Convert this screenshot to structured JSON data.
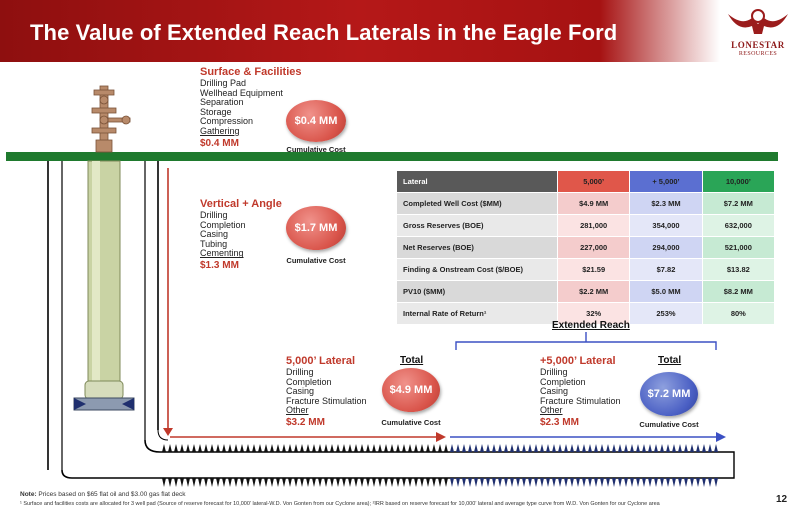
{
  "header": {
    "title": "The Value of Extended Reach Laterals in the Eagle Ford"
  },
  "logo": {
    "name": "LONESTAR",
    "sub": "RESOURCES"
  },
  "surface": {
    "title": "Surface & Facilities",
    "items": [
      "Drilling Pad",
      "Wellhead Equipment",
      "Separation",
      "Storage",
      "Compression",
      "Gathering"
    ],
    "amount": "$0.4 MM",
    "bubble": "$0.4 MM",
    "caption": "Cumulative Cost"
  },
  "vertical": {
    "title": "Vertical + Angle",
    "items": [
      "Drilling",
      "Completion",
      "Casing",
      "Tubing",
      "Cementing"
    ],
    "amount": "$1.3 MM",
    "bubble": "$1.7 MM",
    "caption": "Cumulative Cost"
  },
  "lateral5k": {
    "title": "5,000’ Lateral",
    "items": [
      "Drilling",
      "Completion",
      "Casing",
      "Fracture Stimulation",
      "Other"
    ],
    "amount": "$3.2 MM",
    "total_label": "Total",
    "bubble": "$4.9 MM",
    "caption": "Cumulative Cost"
  },
  "lateralPlus": {
    "title": "+5,000’ Lateral",
    "items": [
      "Drilling",
      "Completion",
      "Casing",
      "Fracture Stimulation",
      "Other"
    ],
    "amount": "$2.3 MM",
    "total_label": "Total",
    "bubble": "$7.2 MM",
    "caption": "Cumulative Cost"
  },
  "extended_reach_label": "Extended Reach",
  "table": {
    "headers": [
      "Lateral",
      "5,000’",
      "+ 5,000’",
      "10,000’"
    ],
    "rows": [
      [
        "Completed Well Cost ($MM)",
        "$4.9 MM",
        "$2.3 MM",
        "$7.2 MM"
      ],
      [
        "Gross Reserves (BOE)",
        "281,000",
        "354,000",
        "632,000"
      ],
      [
        "Net Reserves (BOE)",
        "227,000",
        "294,000",
        "521,000"
      ],
      [
        "Finding & Onstream Cost ($/BOE)",
        "$21.59",
        "$7.82",
        "$13.82"
      ],
      [
        "PV10 ($MM)",
        "$2.2 MM",
        "$5.0 MM",
        "$8.2 MM"
      ],
      [
        "Internal Rate of Return¹",
        "32%",
        "253%",
        "80%"
      ]
    ]
  },
  "footnotes": {
    "note_label": "Note:",
    "note": " Prices based on $65 flat oil and $3.00 gas flat deck",
    "sub": "¹ Surface and facilities costs are allocated for 3 well pad  (Source of reserve forecast for 10,000’ lateral-W.D. Von Gonten from our Cyclone area); ²IRR based on reserve forecast for 10,000’ lateral and average type curve from W.D. Von Gonten for our Cyclone area"
  },
  "page_number": "12",
  "colors": {
    "brand": "#a61212",
    "accent_red": "#d9544a",
    "accent_blue": "#4a5fc4",
    "ground": "#1f7a2e"
  }
}
